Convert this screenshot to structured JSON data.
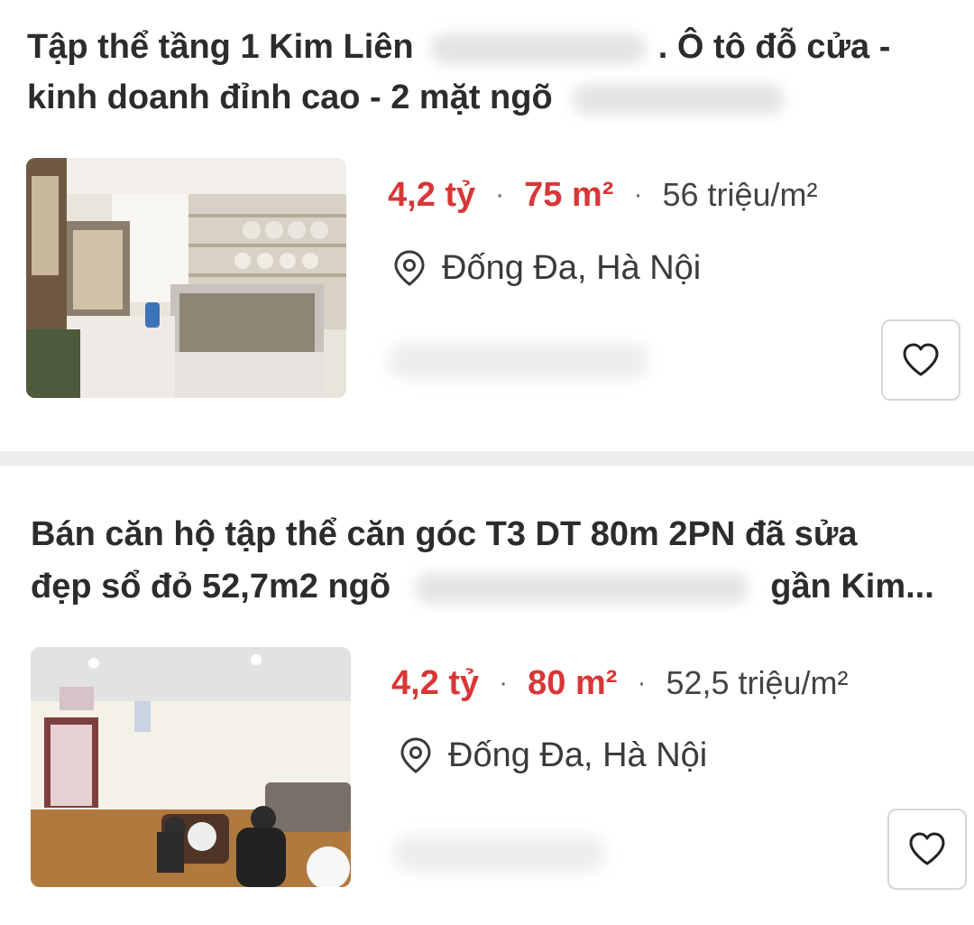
{
  "listings": [
    {
      "title_line1_start": "Tập thể tầng 1 Kim Liên",
      "title_line1_end": ". Ô tô đỗ cửa -",
      "title_line2_start": "kinh doanh đỉnh cao - 2 mặt ngõ",
      "price": "4,2 tỷ",
      "separator": "·",
      "area": "75 m²",
      "price_per_m2": "56 triệu/m²",
      "location": "Đống Đa, Hà Nội",
      "location_icon": "map-pin-icon",
      "favorite_icon": "heart-outline-icon"
    },
    {
      "title_line1": "Bán căn hộ tập thể căn góc T3 DT 80m 2PN đã sửa",
      "title_line2_start": "đẹp sổ đỏ 52,7m2 ngõ",
      "title_line2_end": "gần Kim...",
      "price": "4,2 tỷ",
      "separator": "·",
      "area": "80 m²",
      "price_per_m2": "52,5 triệu/m²",
      "location": "Đống Đa, Hà Nội",
      "location_icon": "map-pin-icon",
      "favorite_icon": "heart-outline-icon"
    }
  ],
  "colors": {
    "price": "#d93636",
    "divider": "#eeeeee",
    "text": "#2c2c2c"
  }
}
